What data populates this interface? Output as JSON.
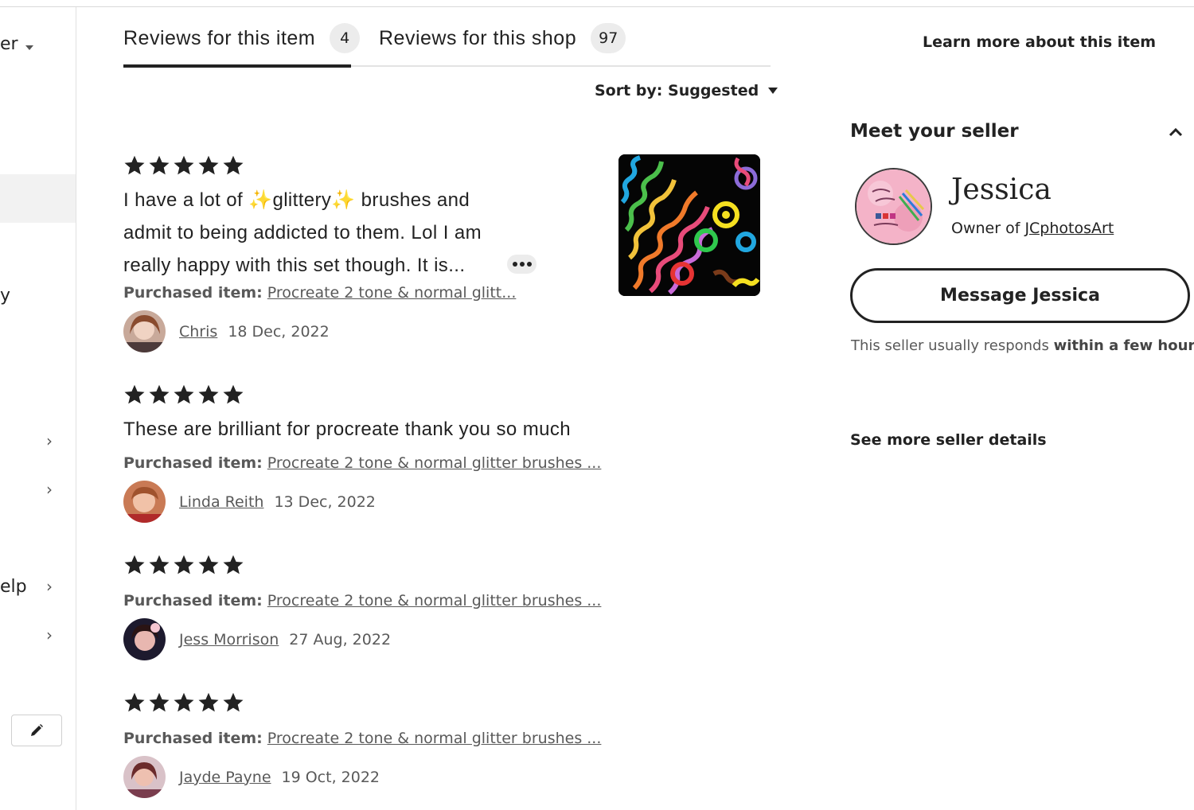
{
  "sidebar": {
    "labels": [
      "er",
      "y",
      "elp"
    ],
    "edit_icon": "pencil-icon"
  },
  "tabs": [
    {
      "label": "Reviews for this item",
      "count": "4",
      "active": true
    },
    {
      "label": "Reviews for this shop",
      "count": "97",
      "active": false
    }
  ],
  "sort": {
    "label": "Sort by: Suggested"
  },
  "reviews": [
    {
      "rating": 5,
      "text_lines": [
        "I have a lot of ✨glittery✨ brushes and",
        "admit to being addicted to them. Lol I am",
        "really happy with this set though. It is..."
      ],
      "purchased_label": "Purchased item:",
      "purchased_item": "Procreate 2 tone & normal glitt...",
      "reviewer": "Chris",
      "date": "18 Dec, 2022",
      "has_photo": true
    },
    {
      "rating": 5,
      "text_lines": [
        "These are brilliant for procreate thank you so much"
      ],
      "purchased_label": "Purchased item:",
      "purchased_item": "Procreate 2 tone & normal glitter brushes ...",
      "reviewer": "Linda Reith",
      "date": "13 Dec, 2022"
    },
    {
      "rating": 5,
      "text_lines": [],
      "purchased_label": "Purchased item:",
      "purchased_item": "Procreate 2 tone & normal glitter brushes ...",
      "reviewer": "Jess Morrison",
      "date": "27 Aug, 2022"
    },
    {
      "rating": 5,
      "text_lines": [],
      "purchased_label": "Purchased item:",
      "purchased_item": "Procreate 2 tone & normal glitter brushes ...",
      "reviewer": "Jayde Payne",
      "date": "19 Oct, 2022"
    }
  ],
  "right": {
    "learn_more": "Learn more about this item",
    "meet_title": "Meet your seller",
    "seller_name": "Jessica",
    "owner_prefix": "Owner of ",
    "shop_name": "JCphotosArt",
    "message_button": "Message Jessica",
    "responds_prefix": "This seller usually responds ",
    "responds_bold": "within a few hours.",
    "see_more": "See more seller details"
  },
  "colors": {
    "text": "#222222",
    "muted": "#595959",
    "pill": "#ececec",
    "divider": "#e3e3e3"
  }
}
